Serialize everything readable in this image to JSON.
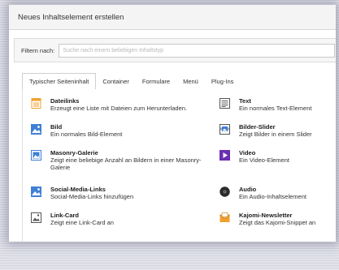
{
  "modal": {
    "title": "Neues Inhaltselement erstellen"
  },
  "filter": {
    "label": "Filtern nach:",
    "placeholder": "Suche nach einem beliebigen Inhaltstyp"
  },
  "tabs": [
    {
      "label": "Typischer Seiteninhalt",
      "active": true
    },
    {
      "label": "Container",
      "active": false
    },
    {
      "label": "Formulare",
      "active": false
    },
    {
      "label": "Menü",
      "active": false
    },
    {
      "label": "Plug-Ins",
      "active": false
    }
  ],
  "elements": [
    {
      "title": "Dateilinks",
      "description": "Erzeugt eine Liste mit Dateien zum Herunterladen.",
      "icon": "file-list-icon"
    },
    {
      "title": "Text",
      "description": "Ein normales Text-Element",
      "icon": "text-icon"
    },
    {
      "title": "Bild",
      "description": "Ein normales Bild-Element",
      "icon": "image-icon"
    },
    {
      "title": "Bilder-Slider",
      "description": "Zeigt Bilder in einem Slider",
      "icon": "slider-icon"
    },
    {
      "title": "Masonry-Galerie",
      "description": "Zeigt eine beliebige Anzahl an Bildern in einer Masonry-Galerie",
      "icon": "gallery-icon"
    },
    {
      "title": "Video",
      "description": "Ein Video-Element",
      "icon": "video-icon"
    },
    {
      "title": "Social-Media-Links",
      "description": "Social-Media-Links hinzufügen",
      "icon": "social-media-icon"
    },
    {
      "title": "Audio",
      "description": "Ein Audio-Inhaltselement",
      "icon": "audio-icon"
    },
    {
      "title": "Link-Card",
      "description": "Zeigt eine Link-Card an",
      "icon": "link-card-icon"
    },
    {
      "title": "Kajomi-Newsletter",
      "description": "Zeigt das Kajomi-Snippet an",
      "icon": "newsletter-icon"
    }
  ],
  "colors": {
    "icon_blue": "#3f7fd6",
    "icon_orange": "#f0a030",
    "icon_purple": "#6a2fb0",
    "icon_dark": "#333333"
  }
}
